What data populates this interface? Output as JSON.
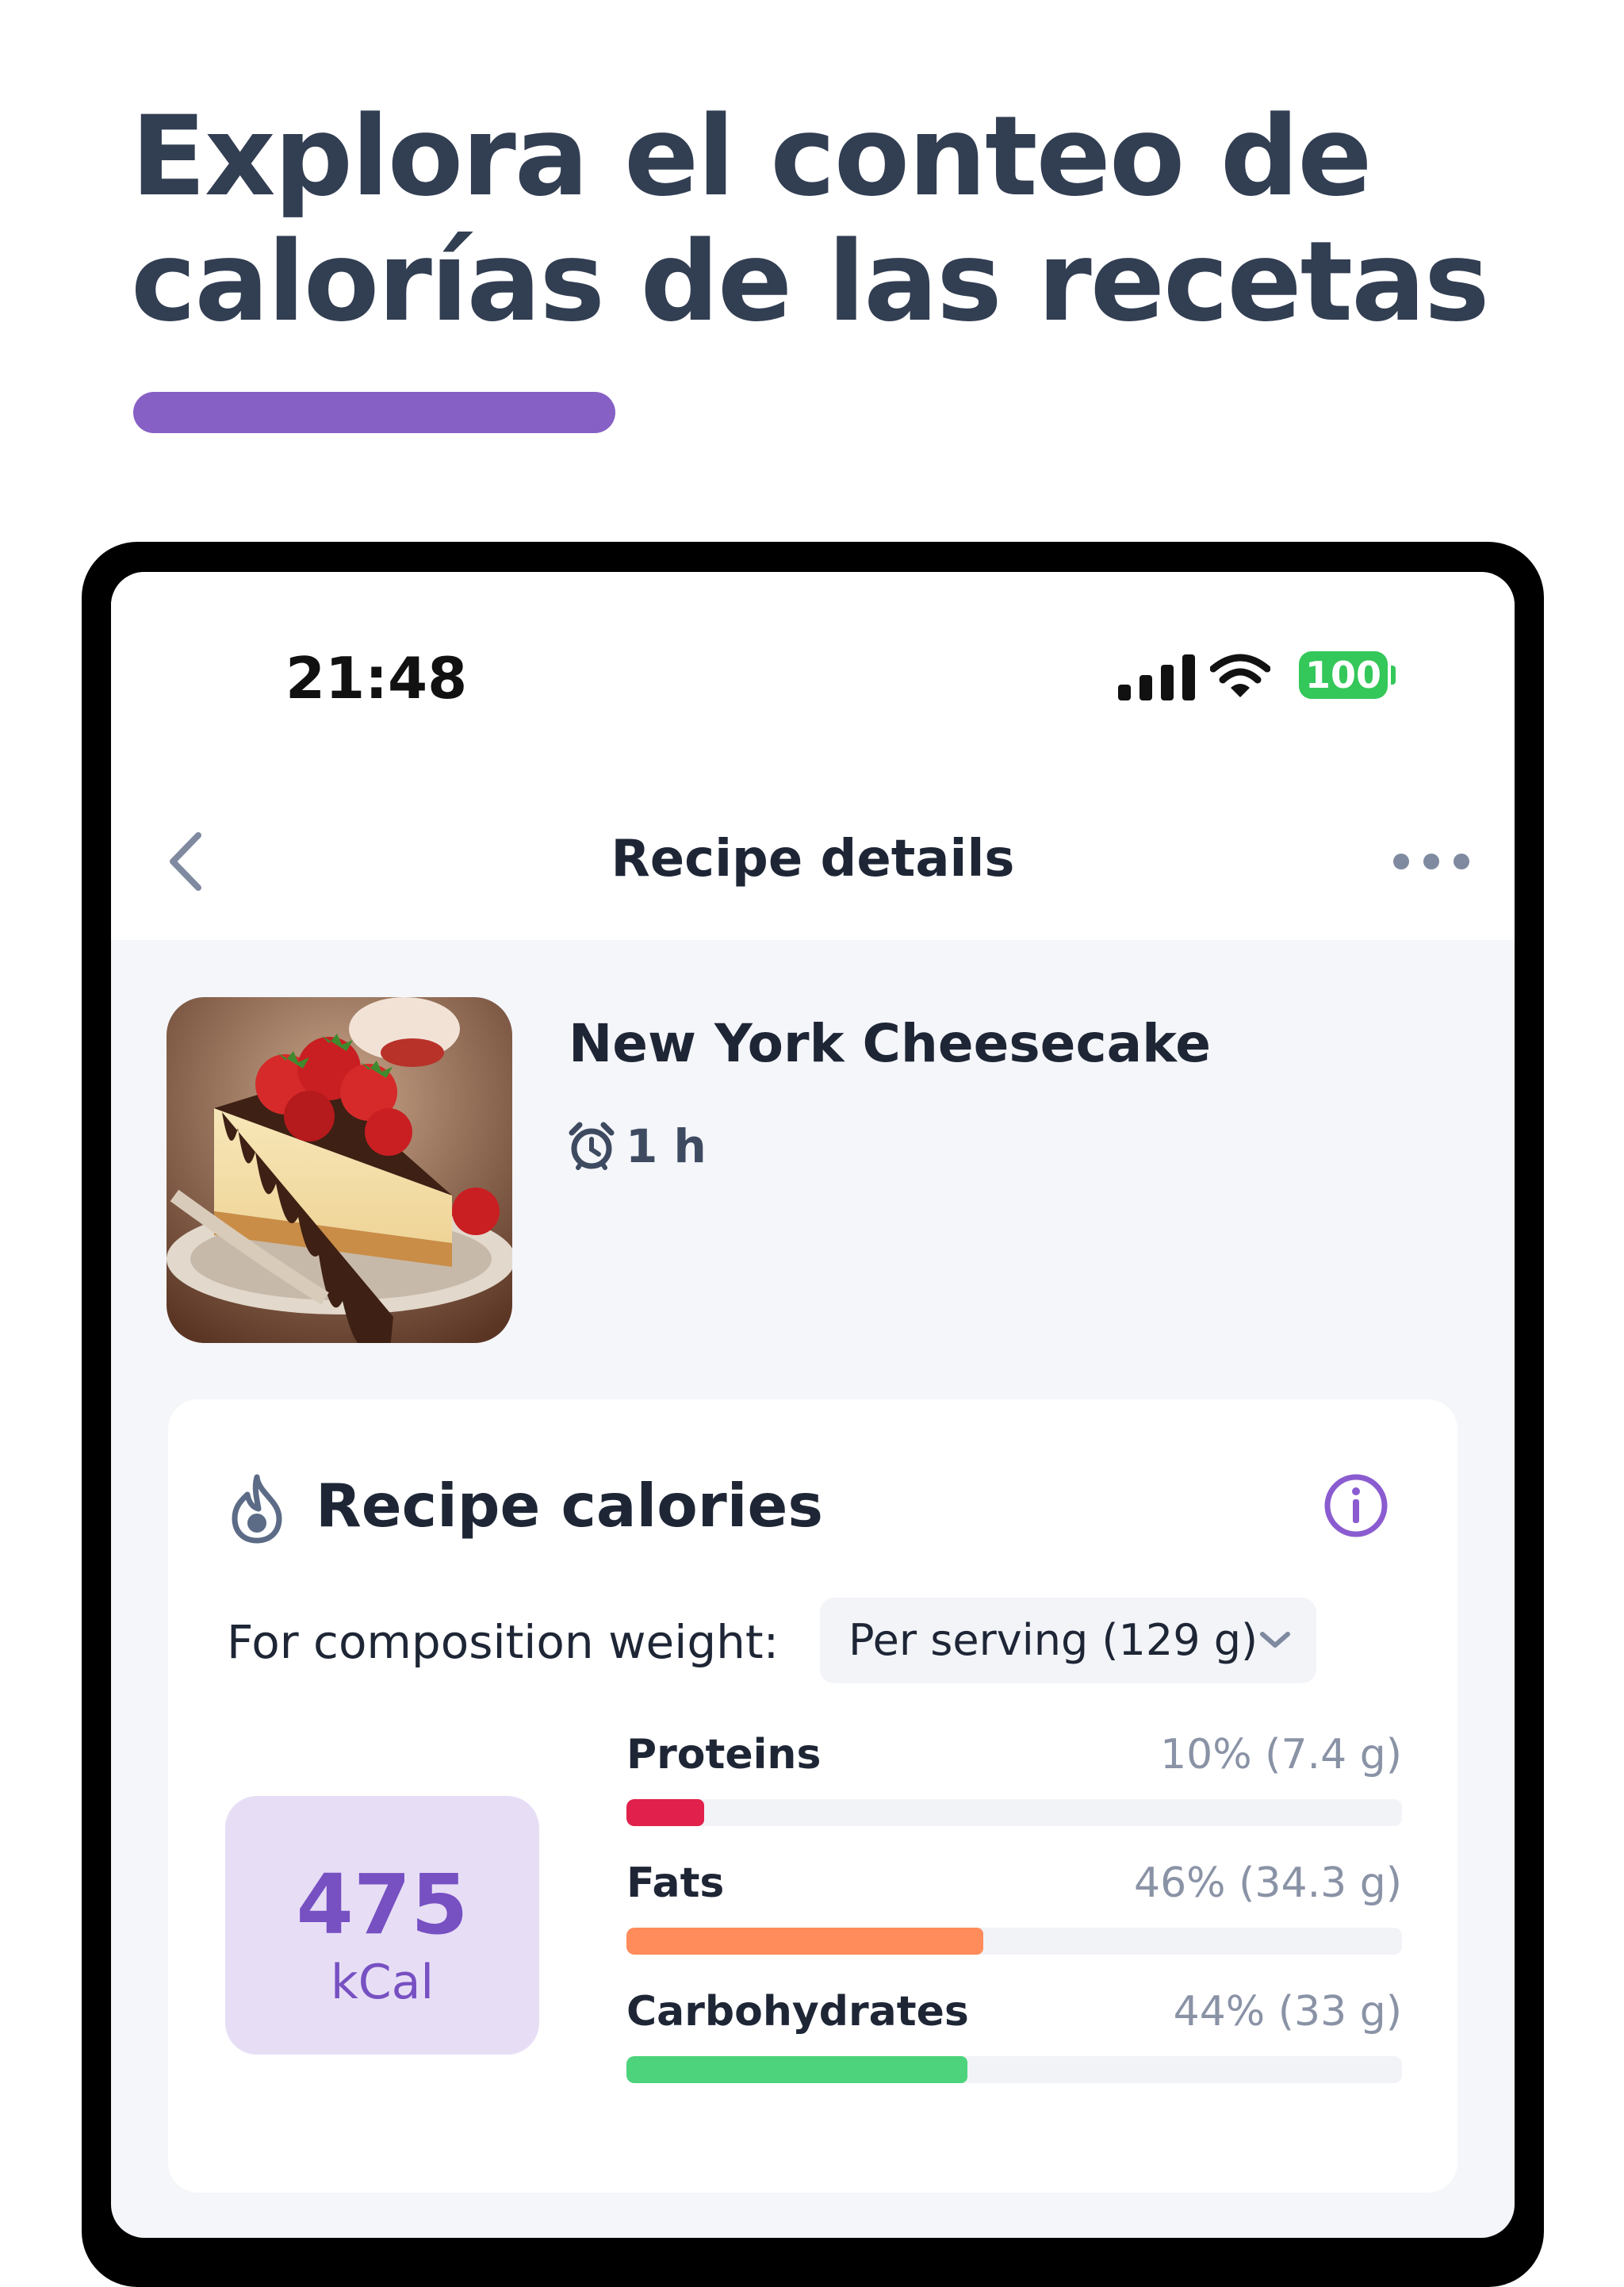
{
  "headline": {
    "line1": "Explora el conteo de",
    "line2": "calorías de las recetas",
    "accent_color": "#8660c5"
  },
  "status_bar": {
    "time": "21:48",
    "battery": "100",
    "icons": [
      "cellular-signal-icon",
      "wifi-icon",
      "battery-icon"
    ]
  },
  "nav": {
    "title": "Recipe details",
    "back_icon": "chevron-left-icon",
    "more_icon": "more-dots-icon"
  },
  "recipe": {
    "name": "New York Cheesecake",
    "time": "1 h",
    "time_icon": "alarm-clock-icon",
    "image": "strawberry-cheesecake-photo"
  },
  "calories_card": {
    "title": "Recipe calories",
    "title_icon": "flame-icon",
    "info_icon": "info-icon",
    "composition_label": "For composition weight:",
    "serving_select": "Per serving (129 g)",
    "kcal_value": "475",
    "kcal_unit": "kCal",
    "macros": [
      {
        "name": "Proteins",
        "value": "10% (7.4 g)",
        "fraction": 0.1,
        "color": "#e2204c"
      },
      {
        "name": "Fats",
        "value": "46% (34.3 g)",
        "fraction": 0.46,
        "color": "#ff8c5a"
      },
      {
        "name": "Carbohydrates",
        "value": "44% (33 g)",
        "fraction": 0.44,
        "color": "#4cd37b"
      }
    ]
  }
}
